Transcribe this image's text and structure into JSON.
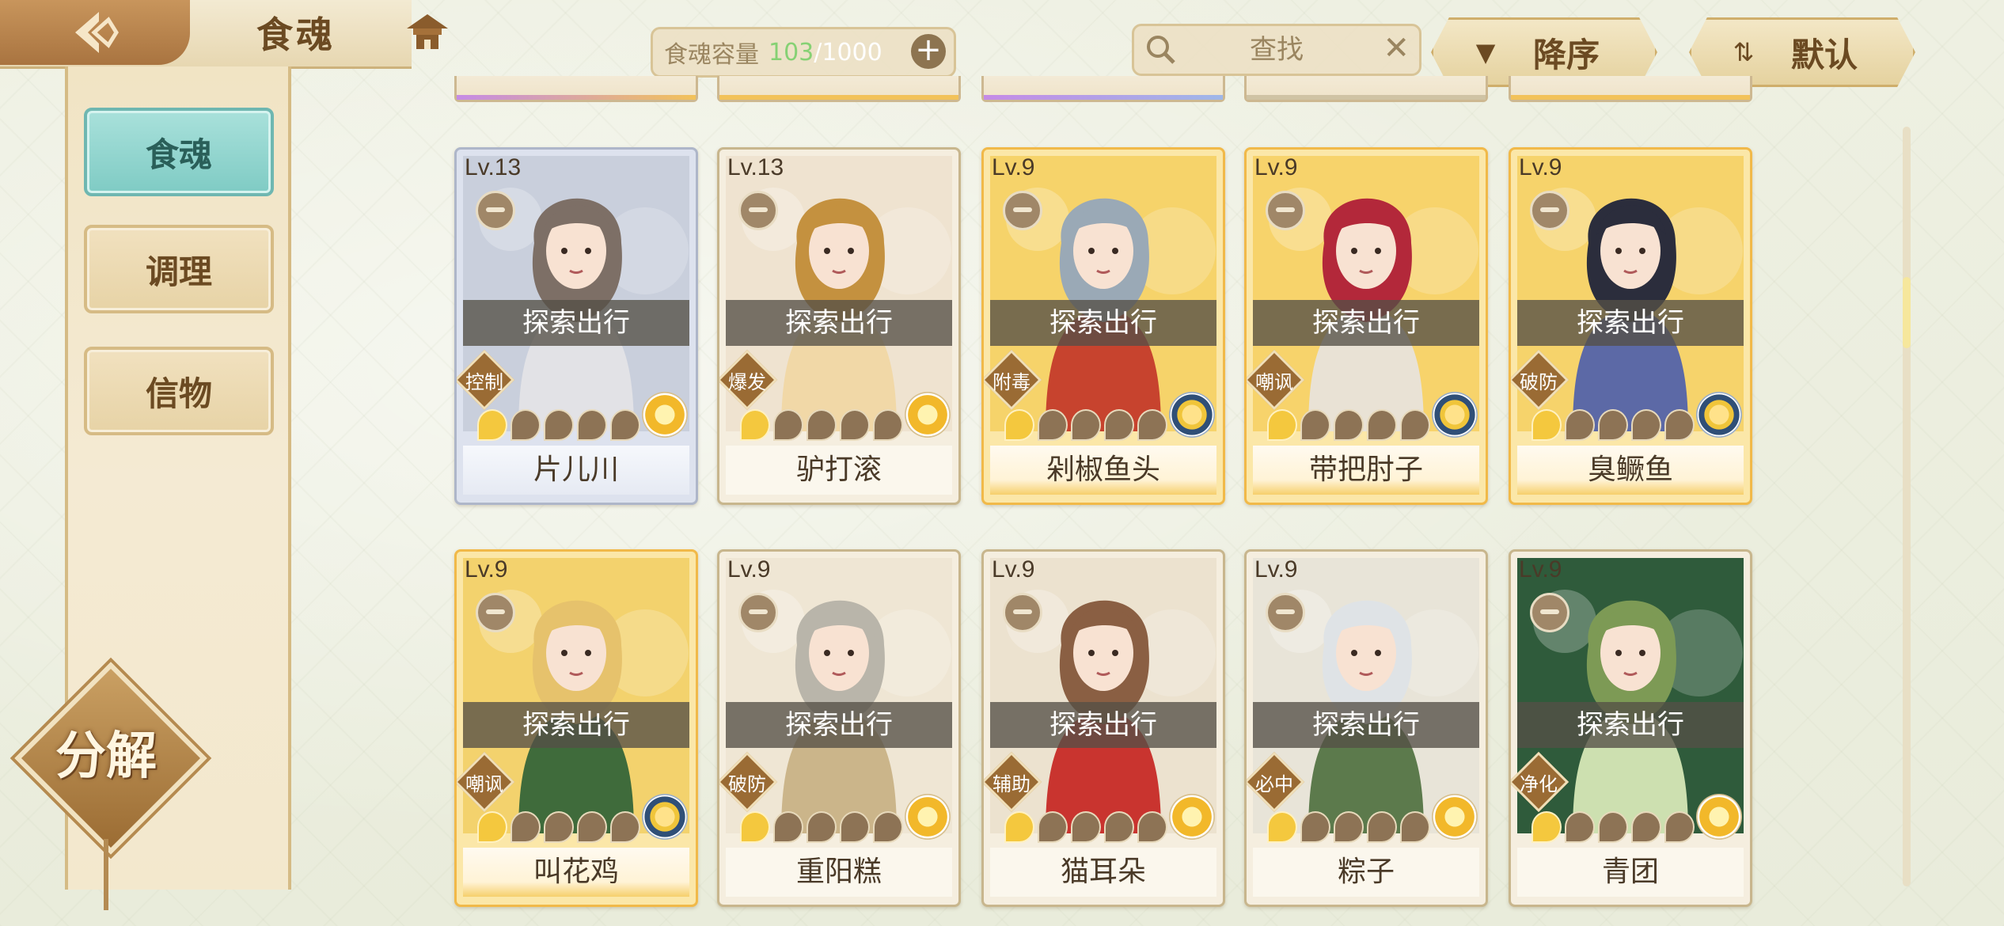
{
  "header": {
    "title": "食魂",
    "capacity": {
      "label": "食魂容量",
      "current": "103",
      "separator": "/",
      "max": "1000"
    },
    "search_label": "查找",
    "sort_order_label": "降序",
    "sort_mode_label": "默认"
  },
  "sidebar": {
    "items": [
      {
        "label": "食魂",
        "active": true
      },
      {
        "label": "调理",
        "active": false
      },
      {
        "label": "信物",
        "active": false
      }
    ],
    "decompose_label": "分解"
  },
  "cards": [
    {
      "level": "Lv.13",
      "status": "探索出行",
      "role": "控制",
      "name": "片儿川",
      "stars_lit": 1,
      "stars_total": 5,
      "rarity": "silver"
    },
    {
      "level": "Lv.13",
      "status": "探索出行",
      "role": "爆发",
      "name": "驴打滚",
      "stars_lit": 1,
      "stars_total": 5,
      "rarity": "normal"
    },
    {
      "level": "Lv.9",
      "status": "探索出行",
      "role": "附毒",
      "name": "剁椒鱼头",
      "stars_lit": 1,
      "stars_total": 5,
      "rarity": "gold"
    },
    {
      "level": "Lv.9",
      "status": "探索出行",
      "role": "嘲讽",
      "name": "带把肘子",
      "stars_lit": 1,
      "stars_total": 5,
      "rarity": "gold"
    },
    {
      "level": "Lv.9",
      "status": "探索出行",
      "role": "破防",
      "name": "臭鳜鱼",
      "stars_lit": 1,
      "stars_total": 5,
      "rarity": "gold"
    },
    {
      "level": "Lv.9",
      "status": "探索出行",
      "role": "嘲讽",
      "name": "叫花鸡",
      "stars_lit": 1,
      "stars_total": 5,
      "rarity": "gold"
    },
    {
      "level": "Lv.9",
      "status": "探索出行",
      "role": "破防",
      "name": "重阳糕",
      "stars_lit": 1,
      "stars_total": 5,
      "rarity": "normal"
    },
    {
      "level": "Lv.9",
      "status": "探索出行",
      "role": "辅助",
      "name": "猫耳朵",
      "stars_lit": 1,
      "stars_total": 5,
      "rarity": "normal"
    },
    {
      "level": "Lv.9",
      "status": "探索出行",
      "role": "必中",
      "name": "粽子",
      "stars_lit": 1,
      "stars_total": 5,
      "rarity": "normal"
    },
    {
      "level": "Lv.9",
      "status": "探索出行",
      "role": "净化",
      "name": "青团",
      "stars_lit": 1,
      "stars_total": 5,
      "rarity": "normal"
    }
  ],
  "colors": {
    "accent_teal": "#7fcbc4",
    "gold_frame": "#f1b949",
    "capacity_green": "#86d174",
    "brown_text": "#6b4a22"
  }
}
